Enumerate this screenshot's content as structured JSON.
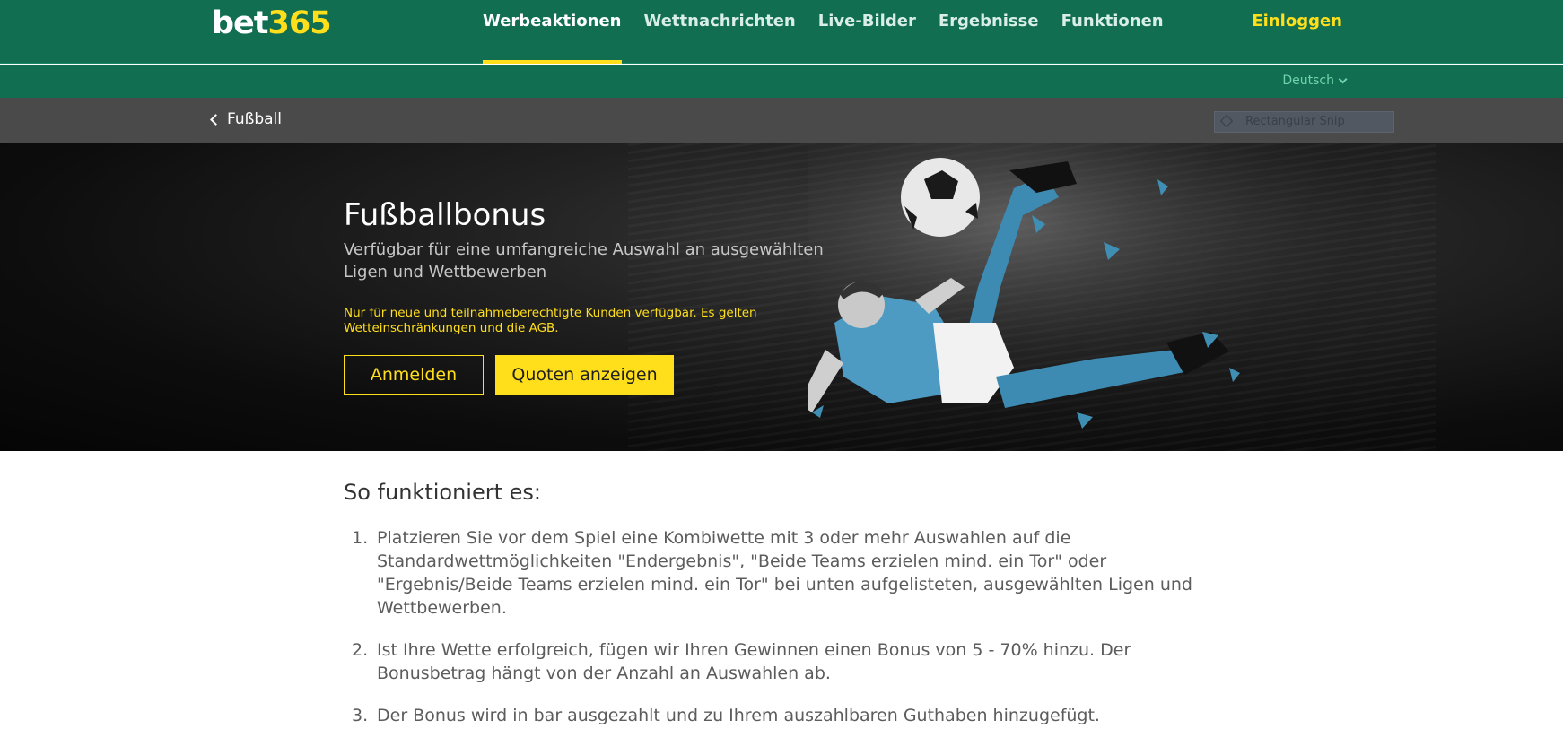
{
  "logo": {
    "text": "bet",
    "num": "365"
  },
  "nav": {
    "items": [
      "Werbeaktionen",
      "Wettnachrichten",
      "Live-Bilder",
      "Ergebnisse",
      "Funktionen"
    ],
    "login": "Einloggen"
  },
  "language": {
    "selected": "Deutsch"
  },
  "breadcrumb": {
    "back_label": "Fußball"
  },
  "snip": {
    "label": "Rectangular Snip"
  },
  "hero": {
    "title": "Fußballbonus",
    "subtitle": "Verfügbar für eine umfangreiche Auswahl an ausgewählten Ligen und Wettbewerben",
    "terms": "Nur für neue und teilnahmeberechtigte Kunden verfügbar. Es gelten Wetteinschränkungen und die AGB.",
    "register_label": "Anmelden",
    "odds_label": "Quoten anzeigen"
  },
  "how": {
    "title": "So funktioniert es:",
    "steps": [
      {
        "num": "1.",
        "text": "Platzieren Sie vor dem Spiel eine Kombiwette mit 3 oder mehr Auswahlen auf die Standardwettmöglichkeiten \"Endergebnis\", \"Beide Teams erzielen mind. ein Tor\" oder \"Ergebnis/Beide Teams erzielen mind. ein Tor\" bei unten aufgelisteten, ausgewählten Ligen und Wettbewerben."
      },
      {
        "num": "2.",
        "text": "Ist Ihre Wette erfolgreich, fügen wir Ihren Gewinnen einen Bonus von 5 - 70% hinzu. Der Bonusbetrag hängt von der Anzahl an Auswahlen ab."
      },
      {
        "num": "3.",
        "text": "Der Bonus wird in bar ausgezahlt und zu Ihrem auszahlbaren Guthaben hinzugefügt."
      }
    ]
  },
  "colors": {
    "brand_green": "#126e51",
    "accent_yellow": "#ffdf1b",
    "crumb_gray": "#4a4a4a"
  }
}
